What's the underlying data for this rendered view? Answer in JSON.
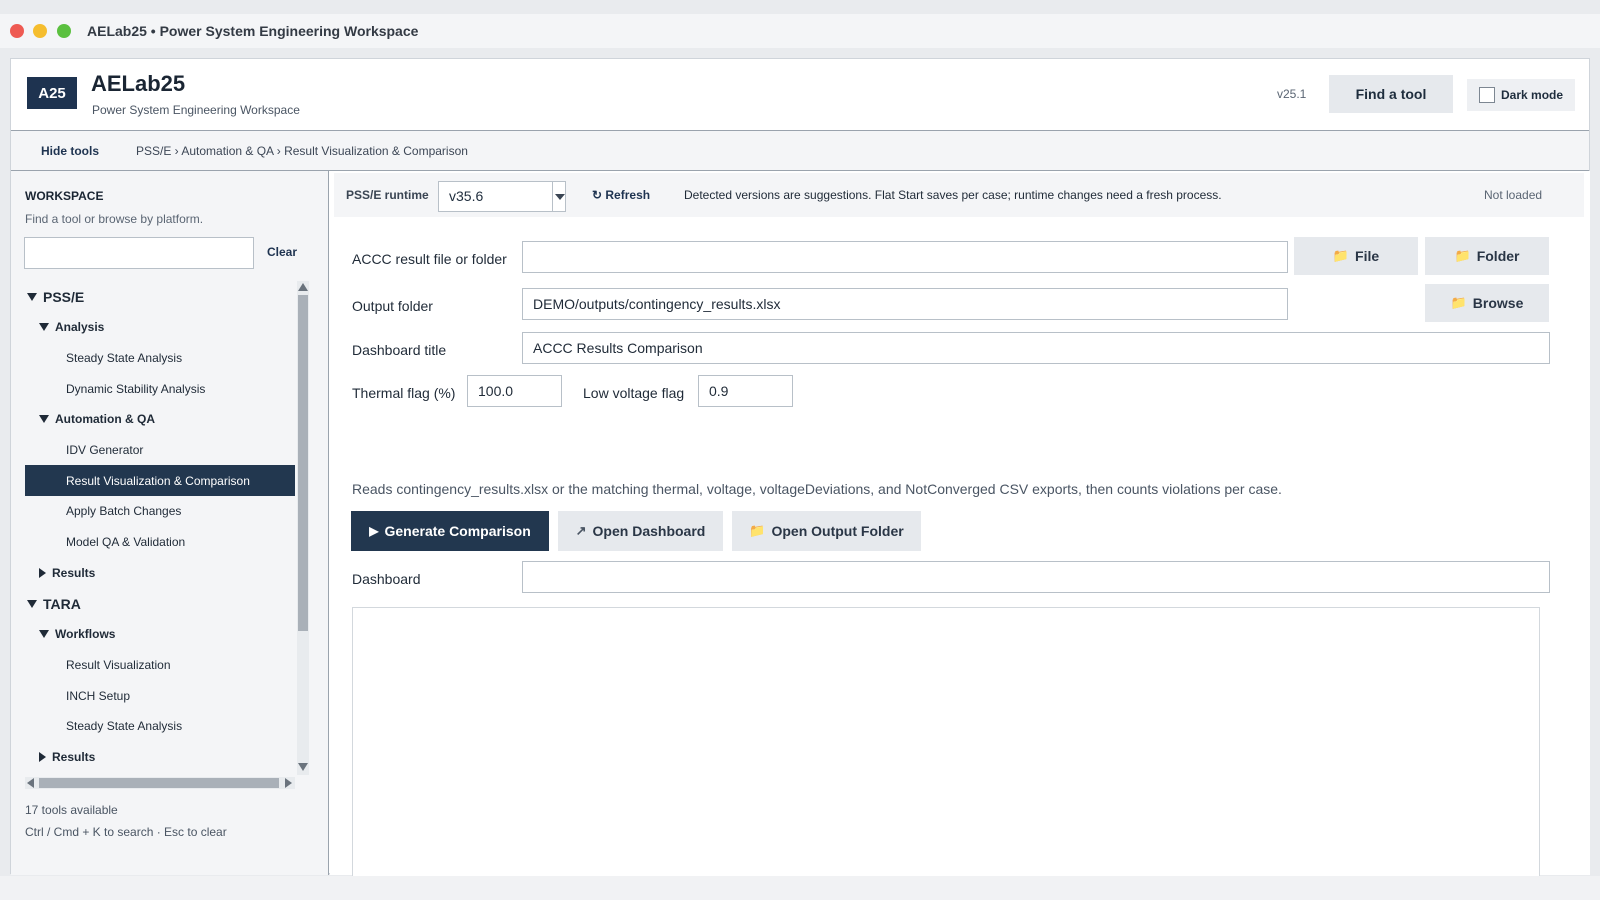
{
  "window": {
    "title": "AELab25 • Power System Engineering Workspace"
  },
  "header": {
    "logo": "A25",
    "title": "AELab25",
    "subtitle": "Power System Engineering Workspace",
    "version": "v25.1",
    "find_tool": "Find a tool",
    "dark_mode": "Dark mode"
  },
  "toolbar": {
    "hide_tools": "Hide tools",
    "breadcrumb": "PSS/E › Automation & QA › Result Visualization & Comparison"
  },
  "sidebar": {
    "title": "WORKSPACE",
    "hint": "Find a tool or browse by platform.",
    "search_value": "",
    "clear": "Clear",
    "tree": [
      {
        "label": "PSS/E",
        "level": 0,
        "expanded": true
      },
      {
        "label": "Analysis",
        "level": 1,
        "expanded": true
      },
      {
        "label": "Steady State Analysis",
        "level": 2
      },
      {
        "label": "Dynamic Stability Analysis",
        "level": 2
      },
      {
        "label": "Automation & QA",
        "level": 1,
        "expanded": true
      },
      {
        "label": "IDV Generator",
        "level": 2
      },
      {
        "label": "Result Visualization & Comparison",
        "level": 2,
        "selected": true
      },
      {
        "label": "Apply Batch Changes",
        "level": 2
      },
      {
        "label": "Model QA & Validation",
        "level": 2
      },
      {
        "label": "Results",
        "level": 1,
        "expanded": false
      },
      {
        "label": "TARA",
        "level": 0,
        "expanded": true
      },
      {
        "label": "Workflows",
        "level": 1,
        "expanded": true
      },
      {
        "label": "Result Visualization",
        "level": 2
      },
      {
        "label": "INCH Setup",
        "level": 2
      },
      {
        "label": "Steady State Analysis",
        "level": 2
      },
      {
        "label": "Results",
        "level": 1,
        "expanded": false
      }
    ],
    "tools_count": "17 tools available",
    "shortcut_hint": "Ctrl / Cmd + K to search · Esc to clear"
  },
  "runtime": {
    "label": "PSS/E runtime",
    "version": "v35.6",
    "refresh": "↻ Refresh",
    "note": "Detected versions are suggestions. Flat Start saves per case; runtime changes need a fresh process.",
    "status": "Not loaded"
  },
  "form": {
    "accc_label": "ACCC result file or folder",
    "accc_value": "",
    "file_btn": "File",
    "folder_btn": "Folder",
    "output_label": "Output folder",
    "output_value": "DEMO/outputs/contingency_results.xlsx",
    "browse_btn": "Browse",
    "dash_title_label": "Dashboard title",
    "dash_title_value": "ACCC Results Comparison",
    "thermal_label": "Thermal flag (%)",
    "thermal_value": "100.0",
    "lowv_label": "Low voltage flag",
    "lowv_value": "0.9",
    "description": "Reads contingency_results.xlsx or the matching thermal, voltage, voltageDeviations, and NotConverged CSV exports, then counts violations per case.",
    "generate": "Generate Comparison",
    "open_dashboard": "Open Dashboard",
    "open_output": "Open Output Folder",
    "dashboard_label": "Dashboard",
    "dashboard_value": ""
  },
  "colors": {
    "accent": "#22374f",
    "button": "#e6e9ed",
    "panel": "#f4f5f7"
  }
}
